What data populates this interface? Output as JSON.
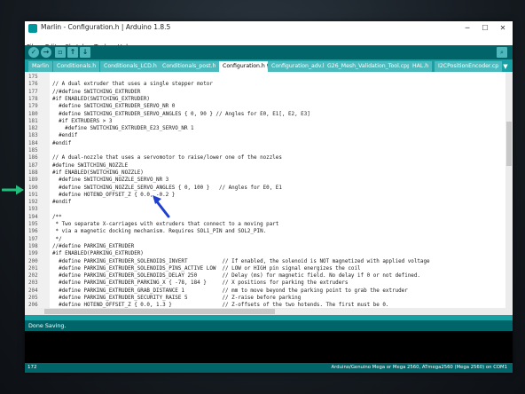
{
  "window": {
    "title": "Marlin - Configuration.h | Arduino 1.8.5"
  },
  "menu": [
    "File",
    "Edit",
    "Sketch",
    "Tools",
    "Help"
  ],
  "toolbar": {
    "buttons": [
      "verify",
      "upload",
      "new",
      "open",
      "save"
    ]
  },
  "tabs": [
    "Marlin",
    "Conditionals.h",
    "Conditionals_LCD.h",
    "Conditionals_post.h",
    "Configuration.h §",
    "Configuration_adv.h",
    "G26_Mesh_Validation_Tool.cpp",
    "HAL.h",
    "I2CPositionEncoder.cp"
  ],
  "active_tab": "Configuration.h §",
  "code_lines": [
    {
      "n": "175",
      "text": ""
    },
    {
      "n": "176",
      "text": "// A dual extruder that uses a single stepper motor"
    },
    {
      "n": "177",
      "text": "//#define SWITCHING_EXTRUDER"
    },
    {
      "n": "178",
      "text": "#if ENABLED(SWITCHING_EXTRUDER)"
    },
    {
      "n": "179",
      "text": "  #define SWITCHING_EXTRUDER_SERVO_NR 0"
    },
    {
      "n": "180",
      "text": "  #define SWITCHING_EXTRUDER_SERVO_ANGLES { 0, 90 } // Angles for E0, E1[, E2, E3]"
    },
    {
      "n": "181",
      "text": "  #if EXTRUDERS > 3"
    },
    {
      "n": "182",
      "text": "    #define SWITCHING_EXTRUDER_E23_SERVO_NR 1"
    },
    {
      "n": "183",
      "text": "  #endif"
    },
    {
      "n": "184",
      "text": "#endif"
    },
    {
      "n": "185",
      "text": ""
    },
    {
      "n": "186",
      "text": "// A dual-nozzle that uses a servomotor to raise/lower one of the nozzles"
    },
    {
      "n": "187",
      "text": "#define SWITCHING_NOZZLE"
    },
    {
      "n": "188",
      "text": "#if ENABLED(SWITCHING_NOZZLE)"
    },
    {
      "n": "189",
      "text": "  #define SWITCHING_NOZZLE_SERVO_NR 3"
    },
    {
      "n": "190",
      "text": "  #define SWITCHING_NOZZLE_SERVO_ANGLES { 0, 100 }   // Angles for E0, E1"
    },
    {
      "n": "191",
      "text": "  #define HOTEND_OFFSET_Z { 0.0, -0.2 }"
    },
    {
      "n": "192",
      "text": "#endif"
    },
    {
      "n": "193",
      "text": ""
    },
    {
      "n": "194",
      "text": "/**"
    },
    {
      "n": "195",
      "text": " * Two separate X-carriages with extruders that connect to a moving part"
    },
    {
      "n": "196",
      "text": " * via a magnetic docking mechanism. Requires SOL1_PIN and SOL2_PIN."
    },
    {
      "n": "197",
      "text": " */"
    },
    {
      "n": "198",
      "text": "//#define PARKING_EXTRUDER"
    },
    {
      "n": "199",
      "text": "#if ENABLED(PARKING_EXTRUDER)"
    },
    {
      "n": "200",
      "text": "  #define PARKING_EXTRUDER_SOLENOIDS_INVERT           // If enabled, the solenoid is NOT magnetized with applied voltage"
    },
    {
      "n": "201",
      "text": "  #define PARKING_EXTRUDER_SOLENOIDS_PINS_ACTIVE LOW  // LOW or HIGH pin signal energizes the coil"
    },
    {
      "n": "202",
      "text": "  #define PARKING_EXTRUDER_SOLENOIDS_DELAY 250        // Delay (ms) for magnetic field. No delay if 0 or not defined."
    },
    {
      "n": "203",
      "text": "  #define PARKING_EXTRUDER_PARKING_X { -78, 184 }     // X positions for parking the extruders"
    },
    {
      "n": "204",
      "text": "  #define PARKING_EXTRUDER_GRAB_DISTANCE 1            // mm to move beyond the parking point to grab the extruder"
    },
    {
      "n": "205",
      "text": "  #define PARKING_EXTRUDER_SECURITY_RAISE 5           // Z-raise before parking"
    },
    {
      "n": "206",
      "text": "  #define HOTEND_OFFSET_Z { 0.0, 1.3 }                // Z-offsets of the two hotends. The first must be 0."
    }
  ],
  "status": {
    "message": "Done Saving."
  },
  "footer": {
    "line": "172",
    "board": "Arduino/Genuino Mega or Mega 2560, ATmega2560 (Mega 2560) on COM1"
  },
  "colors": {
    "accent_dark": "#006468",
    "accent_tab": "#17a1a5",
    "green_arrow": "#1fbe7a",
    "blue_arrow": "#1f3fcf"
  }
}
